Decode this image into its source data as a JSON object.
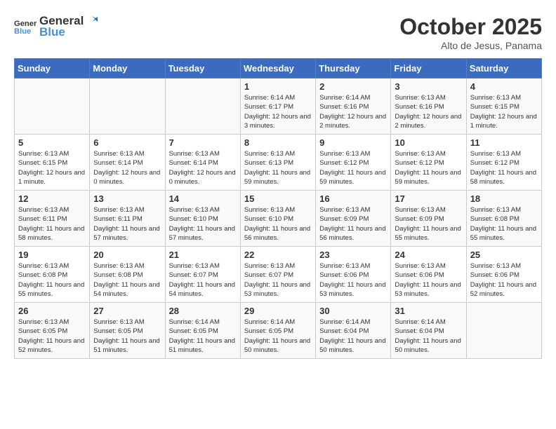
{
  "logo": {
    "line1": "General",
    "line2": "Blue"
  },
  "title": "October 2025",
  "subtitle": "Alto de Jesus, Panama",
  "days_of_week": [
    "Sunday",
    "Monday",
    "Tuesday",
    "Wednesday",
    "Thursday",
    "Friday",
    "Saturday"
  ],
  "weeks": [
    [
      {
        "day": "",
        "info": ""
      },
      {
        "day": "",
        "info": ""
      },
      {
        "day": "",
        "info": ""
      },
      {
        "day": "1",
        "info": "Sunrise: 6:14 AM\nSunset: 6:17 PM\nDaylight: 12 hours and 3 minutes."
      },
      {
        "day": "2",
        "info": "Sunrise: 6:14 AM\nSunset: 6:16 PM\nDaylight: 12 hours and 2 minutes."
      },
      {
        "day": "3",
        "info": "Sunrise: 6:13 AM\nSunset: 6:16 PM\nDaylight: 12 hours and 2 minutes."
      },
      {
        "day": "4",
        "info": "Sunrise: 6:13 AM\nSunset: 6:15 PM\nDaylight: 12 hours and 1 minute."
      }
    ],
    [
      {
        "day": "5",
        "info": "Sunrise: 6:13 AM\nSunset: 6:15 PM\nDaylight: 12 hours and 1 minute."
      },
      {
        "day": "6",
        "info": "Sunrise: 6:13 AM\nSunset: 6:14 PM\nDaylight: 12 hours and 0 minutes."
      },
      {
        "day": "7",
        "info": "Sunrise: 6:13 AM\nSunset: 6:14 PM\nDaylight: 12 hours and 0 minutes."
      },
      {
        "day": "8",
        "info": "Sunrise: 6:13 AM\nSunset: 6:13 PM\nDaylight: 11 hours and 59 minutes."
      },
      {
        "day": "9",
        "info": "Sunrise: 6:13 AM\nSunset: 6:12 PM\nDaylight: 11 hours and 59 minutes."
      },
      {
        "day": "10",
        "info": "Sunrise: 6:13 AM\nSunset: 6:12 PM\nDaylight: 11 hours and 59 minutes."
      },
      {
        "day": "11",
        "info": "Sunrise: 6:13 AM\nSunset: 6:12 PM\nDaylight: 11 hours and 58 minutes."
      }
    ],
    [
      {
        "day": "12",
        "info": "Sunrise: 6:13 AM\nSunset: 6:11 PM\nDaylight: 11 hours and 58 minutes."
      },
      {
        "day": "13",
        "info": "Sunrise: 6:13 AM\nSunset: 6:11 PM\nDaylight: 11 hours and 57 minutes."
      },
      {
        "day": "14",
        "info": "Sunrise: 6:13 AM\nSunset: 6:10 PM\nDaylight: 11 hours and 57 minutes."
      },
      {
        "day": "15",
        "info": "Sunrise: 6:13 AM\nSunset: 6:10 PM\nDaylight: 11 hours and 56 minutes."
      },
      {
        "day": "16",
        "info": "Sunrise: 6:13 AM\nSunset: 6:09 PM\nDaylight: 11 hours and 56 minutes."
      },
      {
        "day": "17",
        "info": "Sunrise: 6:13 AM\nSunset: 6:09 PM\nDaylight: 11 hours and 55 minutes."
      },
      {
        "day": "18",
        "info": "Sunrise: 6:13 AM\nSunset: 6:08 PM\nDaylight: 11 hours and 55 minutes."
      }
    ],
    [
      {
        "day": "19",
        "info": "Sunrise: 6:13 AM\nSunset: 6:08 PM\nDaylight: 11 hours and 55 minutes."
      },
      {
        "day": "20",
        "info": "Sunrise: 6:13 AM\nSunset: 6:08 PM\nDaylight: 11 hours and 54 minutes."
      },
      {
        "day": "21",
        "info": "Sunrise: 6:13 AM\nSunset: 6:07 PM\nDaylight: 11 hours and 54 minutes."
      },
      {
        "day": "22",
        "info": "Sunrise: 6:13 AM\nSunset: 6:07 PM\nDaylight: 11 hours and 53 minutes."
      },
      {
        "day": "23",
        "info": "Sunrise: 6:13 AM\nSunset: 6:06 PM\nDaylight: 11 hours and 53 minutes."
      },
      {
        "day": "24",
        "info": "Sunrise: 6:13 AM\nSunset: 6:06 PM\nDaylight: 11 hours and 53 minutes."
      },
      {
        "day": "25",
        "info": "Sunrise: 6:13 AM\nSunset: 6:06 PM\nDaylight: 11 hours and 52 minutes."
      }
    ],
    [
      {
        "day": "26",
        "info": "Sunrise: 6:13 AM\nSunset: 6:05 PM\nDaylight: 11 hours and 52 minutes."
      },
      {
        "day": "27",
        "info": "Sunrise: 6:13 AM\nSunset: 6:05 PM\nDaylight: 11 hours and 51 minutes."
      },
      {
        "day": "28",
        "info": "Sunrise: 6:14 AM\nSunset: 6:05 PM\nDaylight: 11 hours and 51 minutes."
      },
      {
        "day": "29",
        "info": "Sunrise: 6:14 AM\nSunset: 6:05 PM\nDaylight: 11 hours and 50 minutes."
      },
      {
        "day": "30",
        "info": "Sunrise: 6:14 AM\nSunset: 6:04 PM\nDaylight: 11 hours and 50 minutes."
      },
      {
        "day": "31",
        "info": "Sunrise: 6:14 AM\nSunset: 6:04 PM\nDaylight: 11 hours and 50 minutes."
      },
      {
        "day": "",
        "info": ""
      }
    ]
  ]
}
